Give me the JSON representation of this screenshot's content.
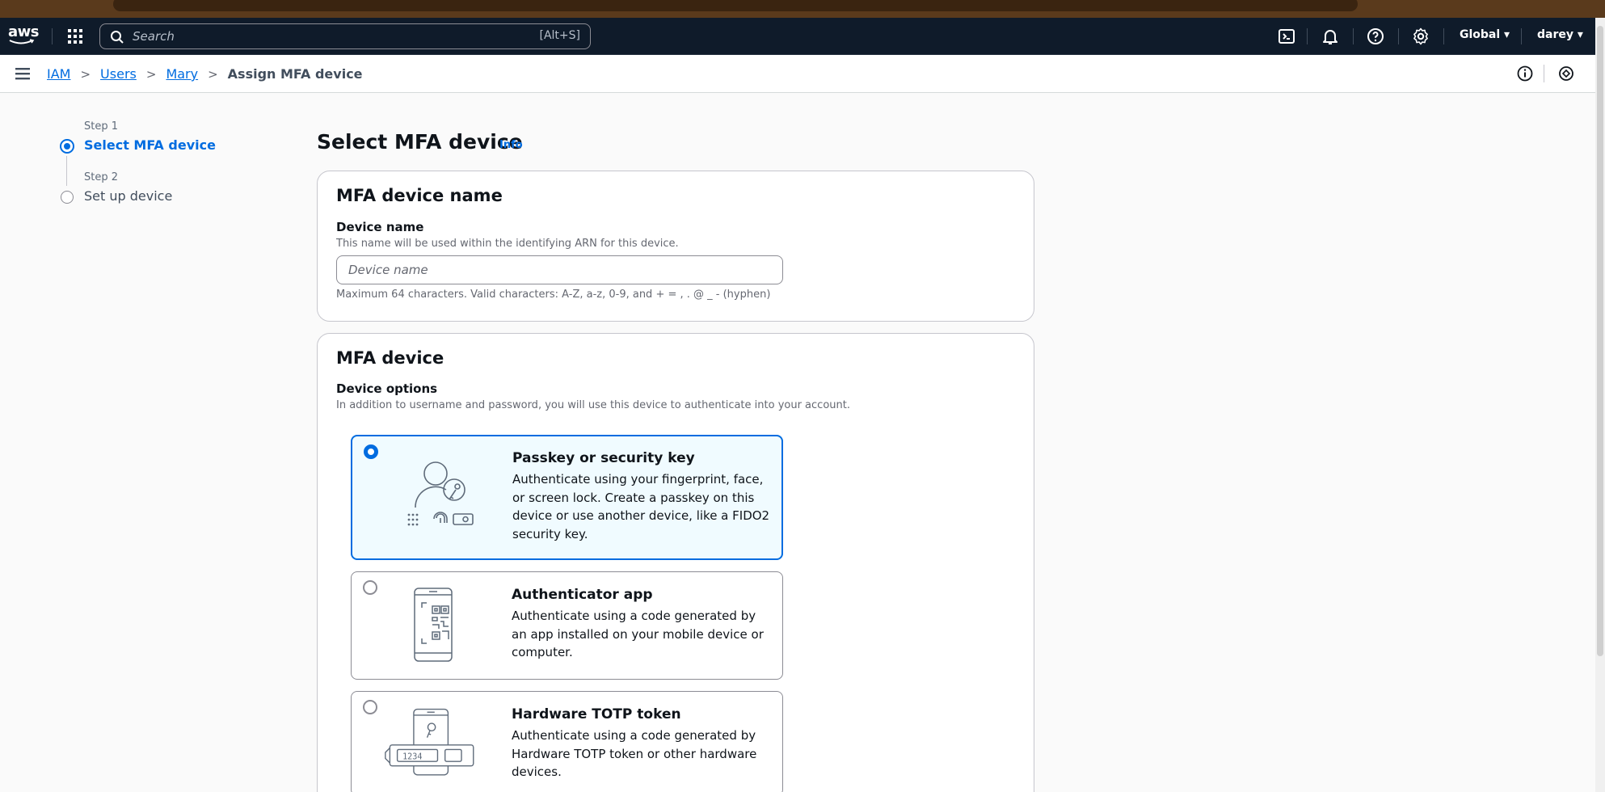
{
  "topnav": {
    "logo_text": "aws",
    "search_placeholder": "Search",
    "search_shortcut": "[Alt+S]",
    "region": "Global ▾",
    "user": "darey ▾"
  },
  "breadcrumb": {
    "items": [
      "IAM",
      "Users",
      "Mary"
    ],
    "current": "Assign MFA device"
  },
  "steps": [
    {
      "label": "Step 1",
      "title": "Select MFA device",
      "active": true
    },
    {
      "label": "Step 2",
      "title": "Set up device",
      "active": false
    }
  ],
  "page": {
    "title": "Select MFA device",
    "info": "Info"
  },
  "name_panel": {
    "heading": "MFA device name",
    "field_label": "Device name",
    "field_desc": "This name will be used within the identifying ARN for this device.",
    "placeholder": "Device name",
    "constraint": "Maximum 64 characters. Valid characters: A-Z, a-z, 0-9, and + = , . @ _ - (hyphen)"
  },
  "device_panel": {
    "heading": "MFA device",
    "options_label": "Device options",
    "options_desc": "In addition to username and password, you will use this device to authenticate into your account.",
    "options": [
      {
        "title": "Passkey or security key",
        "desc": "Authenticate using your fingerprint, face, or screen lock. Create a passkey on this device or use another device, like a FIDO2 security key.",
        "selected": true,
        "icon": "passkey-icon"
      },
      {
        "title": "Authenticator app",
        "desc": "Authenticate using a code generated by an app installed on your mobile device or computer.",
        "selected": false,
        "icon": "authenticator-app-icon"
      },
      {
        "title": "Hardware TOTP token",
        "desc": "Authenticate using a code generated by Hardware TOTP token or other hardware devices.",
        "selected": false,
        "icon": "hardware-token-icon",
        "token_display": "1234"
      }
    ]
  },
  "colors": {
    "nav_bg": "#0f1b2a",
    "link": "#006ce0",
    "selected_bg": "#f0fbff"
  }
}
